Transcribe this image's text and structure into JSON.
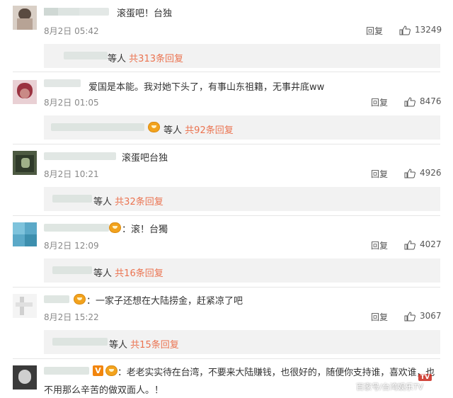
{
  "ui": {
    "reply_label": "回复",
    "sub_prefix": "等人",
    "sub_total_prefix": "共",
    "sub_total_suffix": "条回复"
  },
  "comments": [
    {
      "text": "滚蛋吧！台独",
      "time": "8月2日 05:42",
      "likes": "13249",
      "sub_count": "313"
    },
    {
      "text": "爱国是本能。我对她下头了，有事山东祖籍，无事井底ww",
      "time": "8月2日 01:05",
      "likes": "8476",
      "sub_count": "92"
    },
    {
      "text": "滚蛋吧台独",
      "time": "8月2日 10:21",
      "likes": "4926",
      "sub_count": "32"
    },
    {
      "text": "：滚！台獨",
      "time": "8月2日 12:09",
      "likes": "4027",
      "sub_count": "16"
    },
    {
      "text": "：一家子还想在大陆捞金，赶紧凉了吧",
      "time": "8月2日 15:22",
      "likes": "3067",
      "sub_count": "15"
    },
    {
      "text": "：老老实实待在台湾，不要来大陆赚钱，也很好的，随便你支持谁，喜欢谁，也",
      "text2": "不用那么辛苦的做双面人。！"
    }
  ],
  "watermark": {
    "text": "百家号/台湾娱乐TV",
    "badge": "TV"
  },
  "icons": {
    "like": "thumbs-up-icon",
    "emoji": "emoji-face-icon",
    "verified": "v-badge-icon"
  },
  "colors": {
    "accent": "#eb7350",
    "subbox": "#f2f2f2",
    "muted": "#888888"
  }
}
